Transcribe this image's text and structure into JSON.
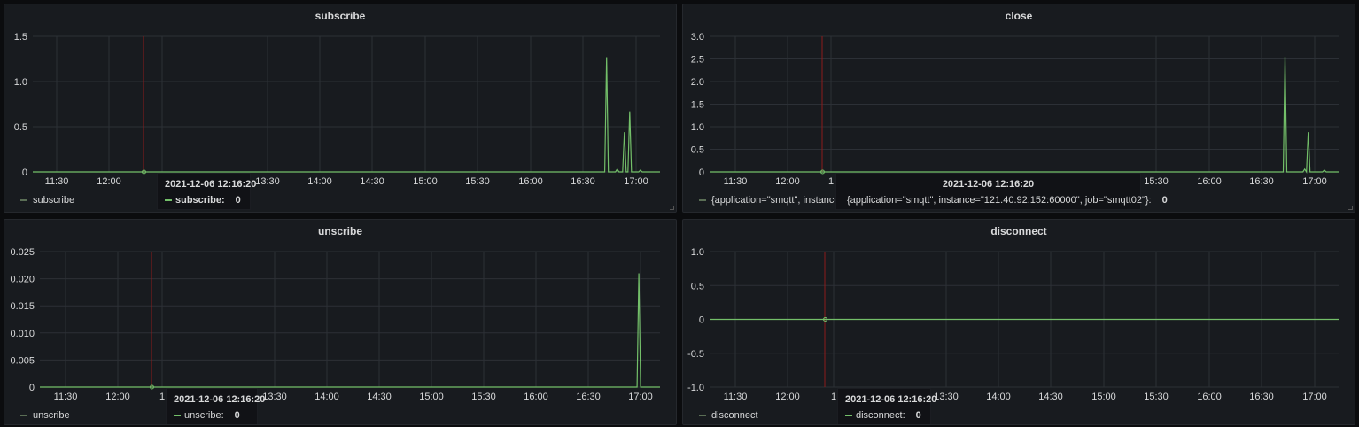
{
  "panels": [
    {
      "title": "subscribe",
      "legend": "subscribe",
      "tooltip": {
        "time": "2021-12-06 12:16:20",
        "label": "subscribe:",
        "value": "0",
        "bold_label": true
      },
      "yticks": [
        "1.5",
        "1.0",
        "0.5",
        "0"
      ],
      "xticks": [
        "11:30",
        "12:00",
        "1",
        "13:30",
        "14:00",
        "14:30",
        "15:00",
        "15:30",
        "16:00",
        "16:30",
        "17:00"
      ],
      "series_color": "#73bf69"
    },
    {
      "title": "close",
      "legend": "{application=\"smqtt\", instance=\"1",
      "tooltip": {
        "time": "2021-12-06 12:16:20",
        "label": "{application=\"smqtt\", instance=\"121.40.92.152:60000\", job=\"smqtt02\"}:",
        "value": "0",
        "bold_label": false
      },
      "yticks": [
        "3.0",
        "2.5",
        "2.0",
        "1.5",
        "1.0",
        "0.5",
        "0"
      ],
      "xticks": [
        "11:30",
        "12:00",
        "1",
        "15:30",
        "16:00",
        "16:30",
        "17:00"
      ],
      "series_color": "#73bf69"
    },
    {
      "title": "unscribe",
      "legend": "unscribe",
      "tooltip": {
        "time": "2021-12-06 12:16:20",
        "label": "unscribe:",
        "value": "0",
        "bold_label": false
      },
      "yticks": [
        "0.025",
        "0.020",
        "0.015",
        "0.010",
        "0.005",
        "0"
      ],
      "xticks": [
        "11:30",
        "12:00",
        "1",
        "13:30",
        "14:00",
        "14:30",
        "15:00",
        "15:30",
        "16:00",
        "16:30",
        "17:00"
      ],
      "series_color": "#73bf69"
    },
    {
      "title": "disconnect",
      "legend": "disconnect",
      "tooltip": {
        "time": "2021-12-06 12:16:20",
        "label": "disconnect:",
        "value": "0",
        "bold_label": false
      },
      "yticks": [
        "1.0",
        "0.5",
        "0",
        "-0.5",
        "-1.0"
      ],
      "xticks": [
        "11:30",
        "12:00",
        "1",
        "13:30",
        "14:00",
        "14:30",
        "15:00",
        "15:30",
        "16:00",
        "16:30",
        "17:00"
      ],
      "series_color": "#73bf69"
    }
  ],
  "chart_data": [
    {
      "type": "line",
      "title": "subscribe",
      "ylim": [
        0,
        1.5
      ],
      "x_range": [
        "11:20",
        "17:12"
      ],
      "series": [
        {
          "name": "subscribe",
          "points": [
            [
              "11:20",
              0
            ],
            [
              "16:40",
              0
            ],
            [
              "16:41",
              0
            ],
            [
              "16:42",
              1.27
            ],
            [
              "16:43",
              0
            ],
            [
              "16:47",
              0
            ],
            [
              "16:48",
              0.03
            ],
            [
              "16:49",
              0
            ],
            [
              "16:51",
              0
            ],
            [
              "16:52",
              0.44
            ],
            [
              "16:53",
              0
            ],
            [
              "16:54",
              0
            ],
            [
              "16:55",
              0.67
            ],
            [
              "16:56",
              0
            ],
            [
              "17:00",
              0
            ],
            [
              "17:01",
              0.02
            ],
            [
              "17:02",
              0
            ],
            [
              "17:12",
              0
            ]
          ]
        }
      ]
    },
    {
      "type": "line",
      "title": "close",
      "ylim": [
        0,
        3.0
      ],
      "x_range": [
        "11:20",
        "17:12"
      ],
      "series": [
        {
          "name": "{application=\"smqtt\", instance=\"121.40.92.152:60000\", job=\"smqtt02\"}",
          "points": [
            [
              "11:20",
              0
            ],
            [
              "16:41",
              0
            ],
            [
              "16:42",
              2.55
            ],
            [
              "16:43",
              0
            ],
            [
              "16:52",
              0
            ],
            [
              "16:53",
              0.06
            ],
            [
              "16:54",
              0
            ],
            [
              "16:55",
              0.88
            ],
            [
              "16:56",
              0
            ],
            [
              "17:03",
              0
            ],
            [
              "17:04",
              0.04
            ],
            [
              "17:05",
              0
            ],
            [
              "17:12",
              0
            ]
          ]
        }
      ]
    },
    {
      "type": "line",
      "title": "unscribe",
      "ylim": [
        0,
        0.025
      ],
      "x_range": [
        "11:20",
        "17:12"
      ],
      "series": [
        {
          "name": "unscribe",
          "points": [
            [
              "11:20",
              0
            ],
            [
              "16:59",
              0
            ],
            [
              "17:00",
              0.021
            ],
            [
              "17:01",
              0
            ],
            [
              "17:12",
              0
            ]
          ]
        }
      ]
    },
    {
      "type": "line",
      "title": "disconnect",
      "ylim": [
        -1.0,
        1.0
      ],
      "x_range": [
        "11:20",
        "17:12"
      ],
      "series": [
        {
          "name": "disconnect",
          "points": [
            [
              "11:20",
              0
            ],
            [
              "17:12",
              0
            ]
          ]
        }
      ]
    }
  ]
}
